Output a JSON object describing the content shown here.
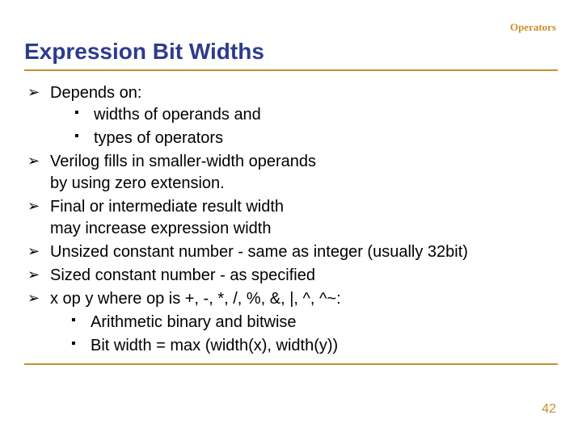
{
  "header": {
    "label": "Operators"
  },
  "title": "Expression Bit Widths",
  "bullets": {
    "b1": "Depends on:",
    "b1_sub1": "widths of operands and",
    "b1_sub2": "types of operators",
    "b2_l1": "Verilog fills in smaller-width operands",
    "b2_l2": "by using zero extension.",
    "b3_l1": "Final or intermediate result width",
    "b3_l2": "may increase expression width",
    "b4": "Unsized constant number - same as integer (usually 32bit)",
    "b5": "Sized constant number - as specified",
    "b6": "x op y where op is +, -, *, /, %, &, |, ^, ^~:",
    "b6_sub1": "Arithmetic binary and bitwise",
    "b6_sub2": "Bit width = max (width(x), width(y))"
  },
  "page_number": "42"
}
